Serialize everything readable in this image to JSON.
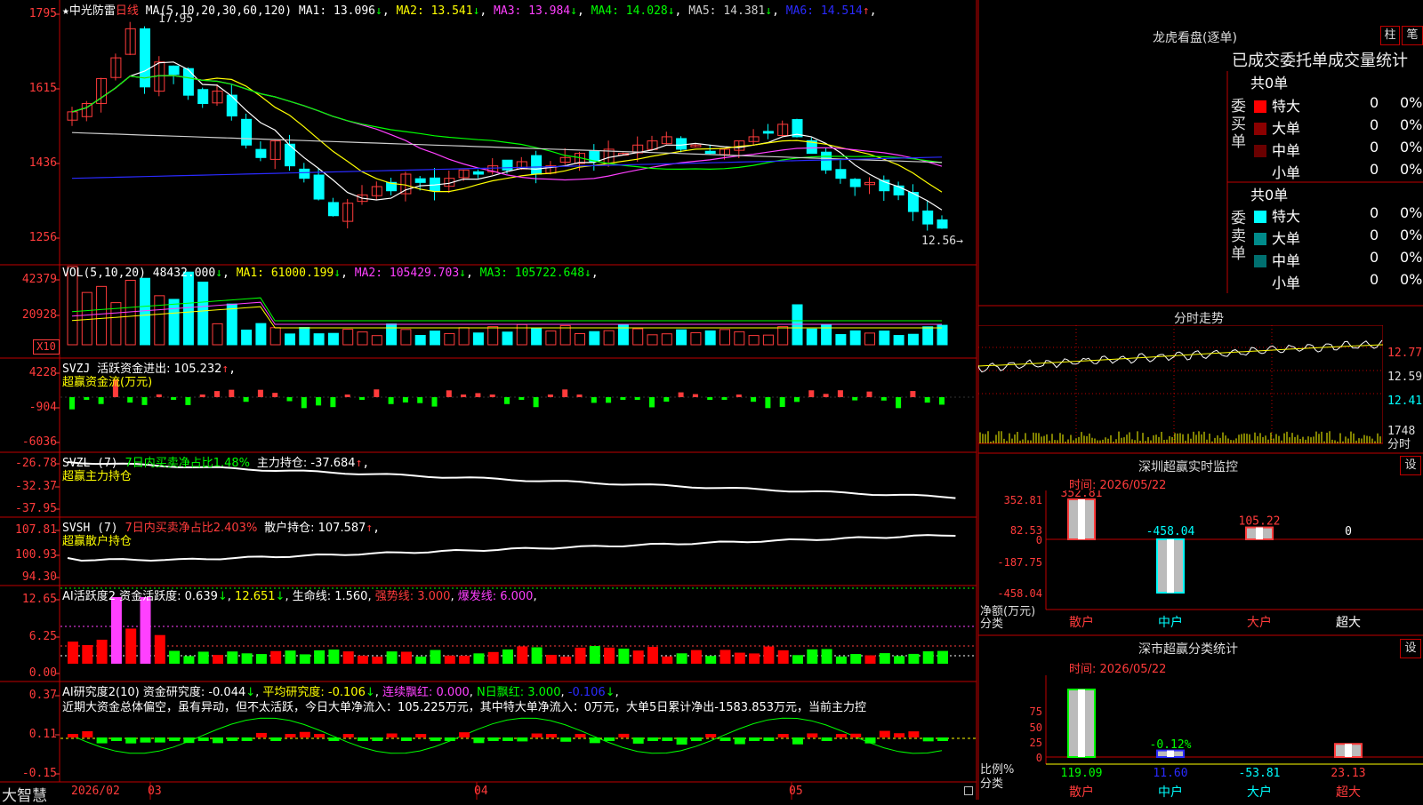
{
  "stock": {
    "title_prefix": "★",
    "name": "中光防雷",
    "period": "日线"
  },
  "main": {
    "ma_params": "MA(5,10,20,30,60,120)",
    "ma": [
      {
        "label": "MA1: 13.096",
        "arrow": "↓",
        "color": "#ffffff"
      },
      {
        "label": "MA2: 13.541",
        "arrow": "↓",
        "color": "#ffff00"
      },
      {
        "label": "MA3: 13.984",
        "arrow": "↓",
        "color": "#ff40ff"
      },
      {
        "label": "MA4: 14.028",
        "arrow": "↓",
        "color": "#00ff00"
      },
      {
        "label": "MA5: 14.381",
        "arrow": "↓",
        "color": "#cfcfcf"
      },
      {
        "label": "MA6: 14.514",
        "arrow": "↑",
        "color": "#2a2aff"
      }
    ],
    "y_ticks": [
      "1795",
      "1615",
      "1436",
      "1256"
    ],
    "high_label": "17.95",
    "low_label": "12.56"
  },
  "vol": {
    "params": "VOL(5,10,20)",
    "value": "48432.000",
    "ma": [
      {
        "label": "MA1: 61000.199",
        "arrow": "↓",
        "color": "#ffff00"
      },
      {
        "label": "MA2: 105429.703",
        "arrow": "↓",
        "color": "#ff40ff"
      },
      {
        "label": "MA3: 105722.648",
        "arrow": "↓",
        "color": "#00ff00"
      }
    ],
    "y_ticks": [
      "42379",
      "20928"
    ],
    "unit": "X10"
  },
  "svzj": {
    "name": "SVZJ",
    "label": "活跃资金进出: 105.232",
    "arrow": "↑",
    "sub": "超赢资金流(万元)",
    "y_ticks": [
      "4228",
      "-904",
      "-6036"
    ]
  },
  "svzl": {
    "name": "SVZL (7)",
    "green_text": "7日内买卖净占比1.48%",
    "label": "主力持仓: -37.684",
    "arrow": "↑",
    "sub": "超赢主力持仓",
    "y_ticks": [
      "-26.78",
      "-32.37",
      "-37.95"
    ]
  },
  "svsh": {
    "name": "SVSH (7)",
    "red_text": "7日内买卖净占比2.403%",
    "label": "散户持仓: 107.587",
    "arrow": "↑",
    "sub": "超赢散户持仓",
    "y_ticks": [
      "107.81",
      "100.93",
      "94.30"
    ]
  },
  "ai1": {
    "name": "AI活跃度2",
    "label1": "资金活跃度: 0.639",
    "label2": "12.651",
    "label3": "生命线: 1.560",
    "label4": "强势线: 3.000",
    "label5": "爆发线: 6.000",
    "y_ticks": [
      "12.65",
      "6.25",
      "0.00"
    ]
  },
  "ai2": {
    "name": "AI研究度2(10)",
    "label1": "资金研究度: -0.044",
    "label2": "平均研究度: -0.106",
    "label3": "连续飘红: 0.000",
    "label4": "N日飘红: 3.000",
    "label5": "-0.106",
    "comment": "近期大资金总体偏空，虽有异动，但不太活跃，今日大单净流入：105.225万元，其中特大单净流入：0万元，大单5日累计净出-1583.853万元，当前主力控",
    "y_ticks": [
      "0.37",
      "0.11",
      "-0.15"
    ]
  },
  "xaxis": {
    "labels": [
      "2026/02",
      "03",
      "04",
      "05"
    ]
  },
  "brand": "大智慧",
  "lhb": {
    "title": "龙虎看盘(逐单)",
    "btn1": "柱",
    "btn2": "笔",
    "subtitle": "已成交委托单成交量统计",
    "buy_total": "共0单",
    "buy_label": "委买单",
    "sell_total": "共0单",
    "sell_label": "委卖单",
    "buy_rows": [
      {
        "name": "特大",
        "count": "0",
        "pct": "0%",
        "color": "#ff0000"
      },
      {
        "name": "大单",
        "count": "0",
        "pct": "0%",
        "color": "#8b0000"
      },
      {
        "name": "中单",
        "count": "0",
        "pct": "0%",
        "color": "#6a0000"
      },
      {
        "name": "小单",
        "count": "0",
        "pct": "0%",
        "color": ""
      }
    ],
    "sell_rows": [
      {
        "name": "特大",
        "count": "0",
        "pct": "0%",
        "color": "#00ffff"
      },
      {
        "name": "大单",
        "count": "0",
        "pct": "0%",
        "color": "#008b8b"
      },
      {
        "name": "中单",
        "count": "0",
        "pct": "0%",
        "color": "#007070"
      },
      {
        "name": "小单",
        "count": "0",
        "pct": "0%",
        "color": ""
      }
    ]
  },
  "intraday": {
    "title": "分时走势",
    "ticks": [
      "12.77",
      "12.59",
      "12.41"
    ],
    "vol_tick": "1748",
    "vol_label": "分时"
  },
  "sz_monitor": {
    "title": "深圳超赢实时监控",
    "btn": "设",
    "date": "时间: 2026/05/22",
    "y_ticks": [
      "352.81",
      "82.53",
      "0",
      "-187.75",
      "-458.04"
    ],
    "y_title1": "净额(万元)",
    "y_title2": "分类",
    "bars": [
      {
        "cat": "散户",
        "value": 352.81,
        "label": "352.81"
      },
      {
        "cat": "中户",
        "value": -458.04,
        "label": "-458.04"
      },
      {
        "cat": "大户",
        "value": 105.22,
        "label": "105.22"
      },
      {
        "cat": "超大",
        "value": 0,
        "label": "0"
      }
    ]
  },
  "sz_class": {
    "title": "深市超赢分类统计",
    "btn": "设",
    "date": "时间: 2026/05/22",
    "y_ticks": [
      "75",
      "50",
      "25",
      "0"
    ],
    "y_title1": "比例%",
    "y_title2": "分类",
    "pct_label": "-0.12%",
    "bars": [
      {
        "cat": "散户",
        "value": 119.09,
        "label": "119.09"
      },
      {
        "cat": "中户",
        "value": 11.6,
        "label": "11.60"
      },
      {
        "cat": "大户",
        "value": -53.81,
        "label": "-53.81"
      },
      {
        "cat": "超大",
        "value": 23.13,
        "label": "23.13"
      }
    ]
  },
  "colors": {
    "up": "#ff3b3b",
    "down": "#00ffff",
    "green": "#00ff00",
    "frame": "#c00000",
    "yellow": "#ffff00",
    "magenta": "#ff40ff"
  }
}
